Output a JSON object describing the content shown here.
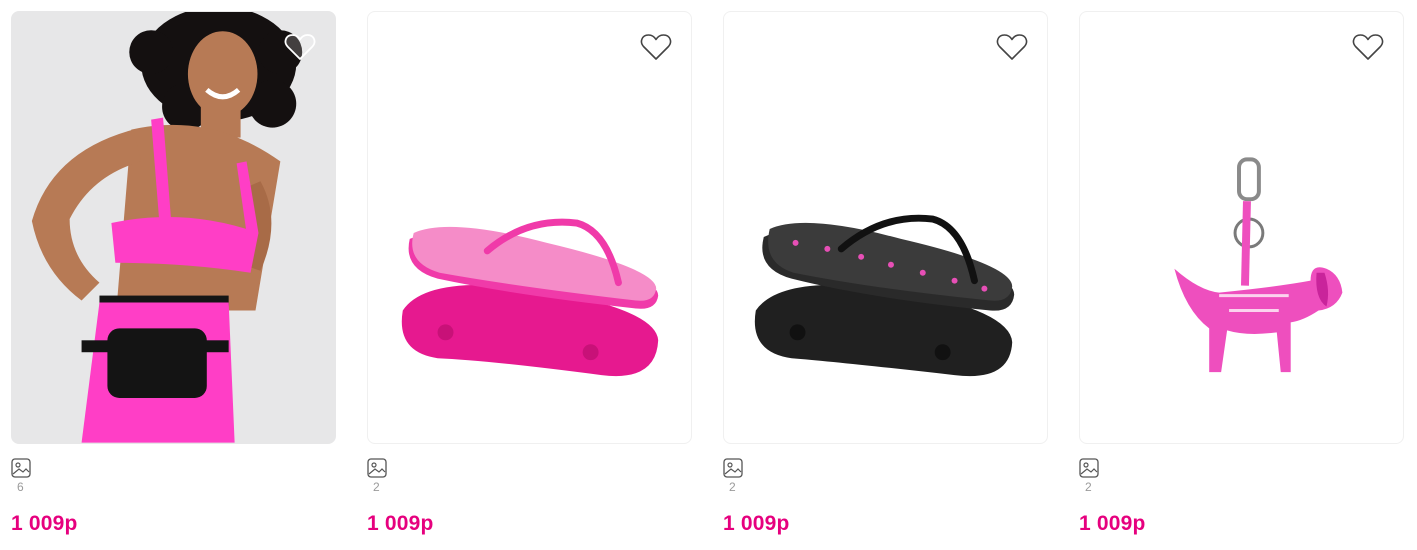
{
  "products": [
    {
      "name": "Pink sport bra, leggings and black belt bag",
      "photos_count": "6",
      "price": "1 009р",
      "image_bg": "#e7e7e8",
      "accent": "#ff3ec6"
    },
    {
      "name": "Pink flip-flops",
      "photos_count": "2",
      "price": "1 009р",
      "image_bg": "#ffffff",
      "accent": "#ef2aa0"
    },
    {
      "name": "Black flip-flops with pink dots",
      "photos_count": "2",
      "price": "1 009р",
      "image_bg": "#ffffff",
      "accent": "#222222"
    },
    {
      "name": "Pink dog keychain",
      "photos_count": "2",
      "price": "1 009р",
      "image_bg": "#ffffff",
      "accent": "#ee4fbe"
    }
  ],
  "icons": {
    "favorite": "heart-outline-icon",
    "photos": "image-gallery-icon"
  },
  "colors": {
    "price": "#e6007e",
    "count": "#9a9a9a",
    "icon": "#555555"
  }
}
